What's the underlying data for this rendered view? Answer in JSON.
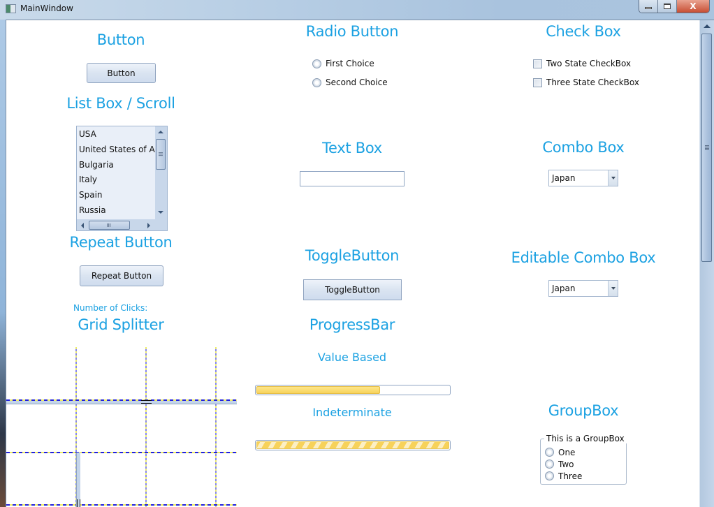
{
  "window": {
    "title": "MainWindow",
    "minimize_label": "",
    "maximize_label": "",
    "close_label": "X"
  },
  "sections": {
    "button": {
      "heading": "Button",
      "button_label": "Button"
    },
    "radio": {
      "heading": "Radio Button",
      "options": [
        "First Choice",
        "Second Choice"
      ]
    },
    "checkbox": {
      "heading": "Check Box",
      "options": [
        {
          "label": "Two State CheckBox",
          "checked": false
        },
        {
          "label": "Three State CheckBox",
          "checked": false
        }
      ]
    },
    "listbox": {
      "heading": "List Box / Scroll",
      "items": [
        "USA",
        "United States of America",
        "Bulgaria",
        "Italy",
        "Spain",
        "Russia"
      ]
    },
    "textbox": {
      "heading": "Text Box",
      "value": ""
    },
    "combobox": {
      "heading": "Combo Box",
      "selected": "Japan"
    },
    "repeat": {
      "heading": "Repeat Button",
      "button_label": "Repeat Button",
      "clicks_label": "Number of Clicks:"
    },
    "toggle": {
      "heading": "ToggleButton",
      "button_label": "ToggleButton"
    },
    "editable_combo": {
      "heading": "Editable Combo Box",
      "value": "Japan"
    },
    "splitter": {
      "heading": "Grid Splitter"
    },
    "progress": {
      "heading": "ProgressBar",
      "value_based_label": "Value Based",
      "value_percent": 64,
      "indeterminate_label": "Indeterminate"
    },
    "groupbox": {
      "heading": "GroupBox",
      "legend": "This is a GroupBox",
      "options": [
        "One",
        "Two",
        "Three"
      ]
    }
  }
}
